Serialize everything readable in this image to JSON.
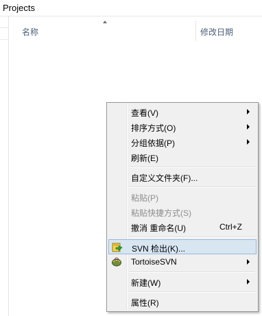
{
  "window": {
    "folder_title": "Projects"
  },
  "columns": {
    "name": "名称",
    "date_modified": "修改日期"
  },
  "context_menu": {
    "items": [
      {
        "label": "查看(V)",
        "has_submenu": true
      },
      {
        "label": "排序方式(O)",
        "has_submenu": true
      },
      {
        "label": "分组依据(P)",
        "has_submenu": true
      },
      {
        "label": "刷新(E)"
      },
      {
        "label": "自定义文件夹(F)..."
      },
      {
        "label": "粘贴(P)",
        "disabled": true
      },
      {
        "label": "粘贴快捷方式(S)",
        "disabled": true
      },
      {
        "label": "撤消 重命名(U)",
        "shortcut": "Ctrl+Z"
      },
      {
        "label": "SVN 检出(K)...",
        "icon": "svn-checkout-icon",
        "highlighted": true
      },
      {
        "label": "TortoiseSVN",
        "icon": "tortoisesvn-icon",
        "has_submenu": true
      },
      {
        "label": "新建(W)",
        "has_submenu": true
      },
      {
        "label": "属性(R)"
      }
    ]
  }
}
